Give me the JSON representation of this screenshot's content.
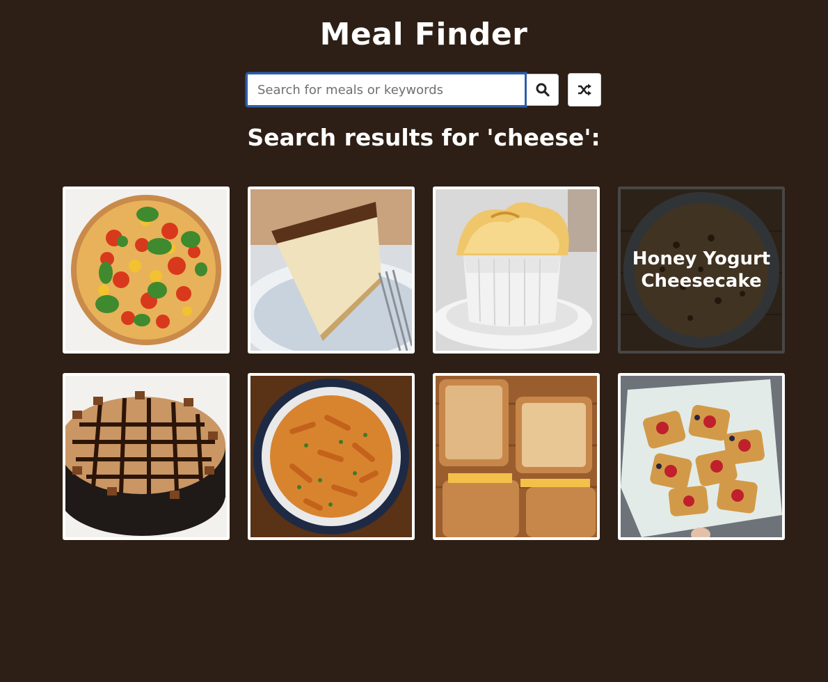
{
  "app": {
    "title": "Meal Finder"
  },
  "search": {
    "placeholder": "Search for meals or keywords",
    "value": ""
  },
  "buttons": {
    "search_icon": "search-icon",
    "random_icon": "shuffle-icon"
  },
  "results": {
    "heading": "Search results for 'cheese':",
    "meals": [
      {
        "image": "tomato-basil-tart"
      },
      {
        "image": "baked-cheesecake-slice"
      },
      {
        "image": "cheese-souffle"
      },
      {
        "image": "round-tart",
        "name": "Honey Yogurt Cheesecake"
      },
      {
        "image": "peanut-butter-cup-cheesecake"
      },
      {
        "image": "cheesy-pasta-bowl"
      },
      {
        "image": "grilled-cheese-sandwiches"
      },
      {
        "image": "strawberry-cheese-danish"
      }
    ]
  }
}
